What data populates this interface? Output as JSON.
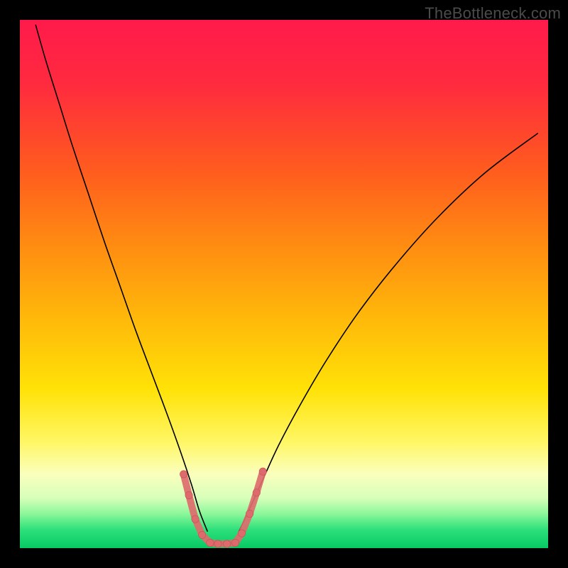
{
  "watermark": "TheBottleneck.com",
  "chart_data": {
    "type": "line",
    "title": "",
    "xlabel": "",
    "ylabel": "",
    "xlim": [
      0,
      100
    ],
    "ylim": [
      0,
      100
    ],
    "grid": false,
    "legend": false,
    "background_gradient_stops": [
      {
        "offset": 0.0,
        "color": "#ff1a4b"
      },
      {
        "offset": 0.12,
        "color": "#ff2a3f"
      },
      {
        "offset": 0.28,
        "color": "#ff5a1f"
      },
      {
        "offset": 0.42,
        "color": "#ff8a12"
      },
      {
        "offset": 0.56,
        "color": "#ffb70a"
      },
      {
        "offset": 0.7,
        "color": "#ffe207"
      },
      {
        "offset": 0.8,
        "color": "#fff766"
      },
      {
        "offset": 0.86,
        "color": "#faffbd"
      },
      {
        "offset": 0.905,
        "color": "#d7ffba"
      },
      {
        "offset": 0.935,
        "color": "#8cf79a"
      },
      {
        "offset": 0.965,
        "color": "#2de07b"
      },
      {
        "offset": 1.0,
        "color": "#07c964"
      }
    ],
    "series": [
      {
        "name": "left_curve",
        "style": "solid",
        "color": "#000000",
        "width": 1.6,
        "x": [
          3.0,
          5.0,
          7.5,
          10.0,
          13.0,
          16.0,
          19.0,
          22.0,
          25.0,
          28.0,
          30.5,
          32.5,
          34.0,
          35.5
        ],
        "values": [
          99.0,
          92.0,
          84.0,
          76.0,
          67.0,
          58.0,
          49.5,
          41.0,
          33.0,
          25.0,
          18.0,
          12.0,
          7.0,
          3.2
        ]
      },
      {
        "name": "right_curve",
        "style": "solid",
        "color": "#000000",
        "width": 1.6,
        "x": [
          41.5,
          43.5,
          46.0,
          49.0,
          53.0,
          58.0,
          64.0,
          71.0,
          79.0,
          88.0,
          98.0
        ],
        "values": [
          3.2,
          7.5,
          13.0,
          19.5,
          27.0,
          35.5,
          44.5,
          53.5,
          62.5,
          71.0,
          78.5
        ]
      },
      {
        "name": "valley_band",
        "style": "marker_band",
        "fill": "#dd6b6d",
        "stroke": "#c64f55",
        "marker_r": 5.2,
        "x": [
          31.0,
          32.0,
          33.2,
          34.5,
          36.0,
          37.5,
          39.2,
          40.8,
          42.0,
          43.5,
          44.8,
          46.0
        ],
        "values": [
          14.0,
          10.0,
          5.5,
          2.5,
          1.0,
          0.8,
          0.8,
          1.0,
          2.8,
          6.5,
          10.5,
          14.5
        ]
      }
    ]
  }
}
